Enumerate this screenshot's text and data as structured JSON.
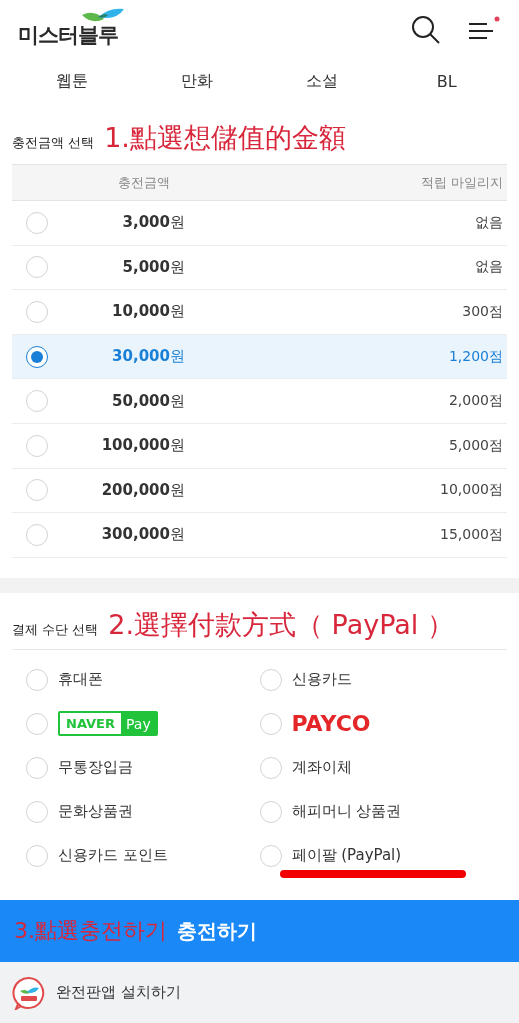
{
  "header": {
    "logo": "미스터블루",
    "notification": true
  },
  "tabs": [
    {
      "label": "웹툰"
    },
    {
      "label": "만화"
    },
    {
      "label": "소설"
    },
    {
      "label": "BL"
    }
  ],
  "amount_section": {
    "title": "충전금액 선택",
    "annotation": "1.點選想儲值的金額",
    "columns": [
      "충전금액",
      "적립 마일리지"
    ],
    "rows": [
      {
        "amount": "3,000",
        "unit": "원",
        "mileage": "없음",
        "selected": false
      },
      {
        "amount": "5,000",
        "unit": "원",
        "mileage": "없음",
        "selected": false
      },
      {
        "amount": "10,000",
        "unit": "원",
        "mileage": "300점",
        "selected": false
      },
      {
        "amount": "30,000",
        "unit": "원",
        "mileage": "1,200점",
        "selected": true
      },
      {
        "amount": "50,000",
        "unit": "원",
        "mileage": "2,000점",
        "selected": false
      },
      {
        "amount": "100,000",
        "unit": "원",
        "mileage": "5,000점",
        "selected": false
      },
      {
        "amount": "200,000",
        "unit": "원",
        "mileage": "10,000점",
        "selected": false
      },
      {
        "amount": "300,000",
        "unit": "원",
        "mileage": "15,000점",
        "selected": false
      }
    ]
  },
  "payment_section": {
    "title": "결제 수단 선택",
    "annotation": "2.選擇付款方式（ PayPal ）",
    "methods": [
      {
        "kind": "text",
        "label": "휴대폰",
        "selected": false
      },
      {
        "kind": "text",
        "label": "신용카드",
        "selected": false
      },
      {
        "kind": "naver",
        "label": "NAVER",
        "suffix": "Pay",
        "selected": false
      },
      {
        "kind": "payco",
        "label": "PAYCO",
        "selected": false
      },
      {
        "kind": "text",
        "label": "무통장입금",
        "selected": false
      },
      {
        "kind": "text",
        "label": "계좌이체",
        "selected": false
      },
      {
        "kind": "text",
        "label": "문화상품권",
        "selected": false
      },
      {
        "kind": "text",
        "label": "해피머니 상품권",
        "selected": false
      },
      {
        "kind": "text",
        "label": "신용카드 포인트",
        "selected": false
      },
      {
        "kind": "text",
        "label": "페이팔 (PayPal)",
        "selected": false,
        "underlined": true
      }
    ]
  },
  "charge_button": {
    "annotation": "3.點選충전하기",
    "label": "충전하기"
  },
  "footer": {
    "label": "완전판앱 설치하기"
  }
}
